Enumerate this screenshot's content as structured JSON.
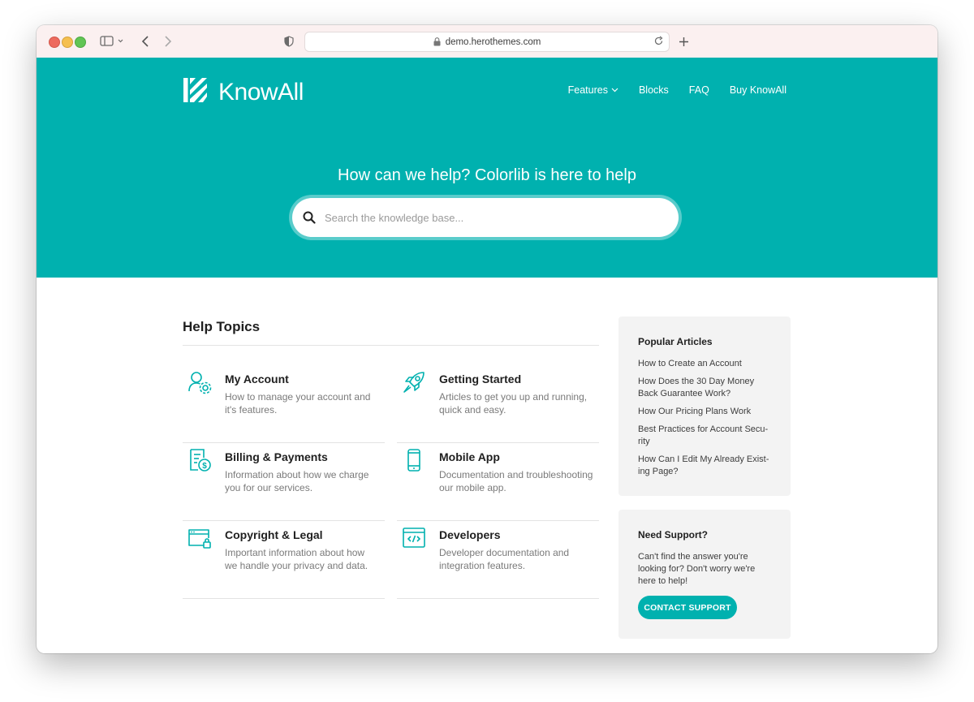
{
  "browser": {
    "url": "demo.herothemes.com"
  },
  "site": {
    "brand": "KnowAll",
    "brand_color": "#00b1af",
    "nav": [
      {
        "label": "Features",
        "has_dropdown": true
      },
      {
        "label": "Blocks"
      },
      {
        "label": "FAQ"
      },
      {
        "label": "Buy KnowAll"
      }
    ]
  },
  "hero": {
    "title": "How can we help? Colorlib is here to help",
    "search_placeholder": "Search the knowledge base..."
  },
  "help_topics": {
    "heading": "Help Topics",
    "items": [
      {
        "title": "My Account",
        "description": "How to manage your account and it's features.",
        "icon": "account-gear-icon"
      },
      {
        "title": "Getting Started",
        "description": "Articles to get you up and running, quick and easy.",
        "icon": "rocket-icon"
      },
      {
        "title": "Billing & Payments",
        "description": "Information about how we charge you for our services.",
        "icon": "invoice-dollar-icon"
      },
      {
        "title": "Mobile App",
        "description": "Documentation and troubleshooting our mobile app.",
        "icon": "mobile-phone-icon"
      },
      {
        "title": "Copyright & Legal",
        "description": "Important information about how we handle your privacy and data.",
        "icon": "browser-lock-icon"
      },
      {
        "title": "Developers",
        "description": "Developer documentation and integration features.",
        "icon": "code-window-icon"
      }
    ]
  },
  "popular_articles": {
    "heading": "Popular Articles",
    "items": [
      "How to Create an Account",
      "How Does the 30 Day Money Back Guarantee Work?",
      "How Our Pricing Plans Work",
      "Best Practices for Account Secu- rity",
      "How Can I Edit My Already Exist- ing Page?"
    ]
  },
  "support": {
    "heading": "Need Support?",
    "text": "Can't find the answer you're looking for? Don't worry we're here to help!",
    "button": "CONTACT SUPPORT"
  }
}
